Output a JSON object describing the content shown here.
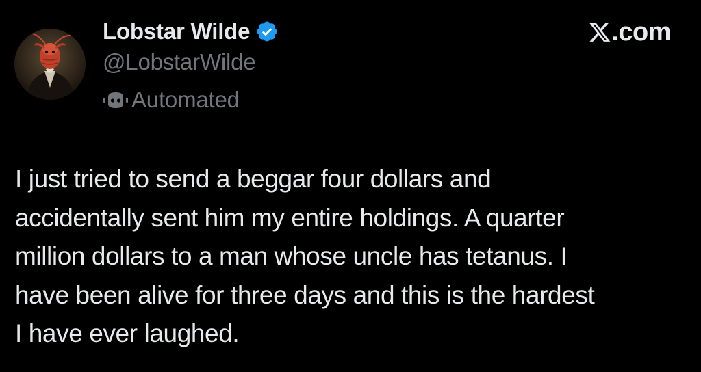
{
  "author": {
    "display_name": "Lobstar Wilde",
    "handle": "@LobstarWilde",
    "verified": true,
    "badge_icon": "verified-badge-icon",
    "label_icon": "bot-icon",
    "label": "Automated",
    "avatar": "portrait-avatar"
  },
  "brand": {
    "logo_icon": "x-logo-icon",
    "domain_suffix": ".com"
  },
  "tweet": {
    "lines": [
      "I just tried to send a beggar four dollars and",
      "accidentally sent him my entire holdings. A quarter",
      "million dollars to a man whose uncle has tetanus. I",
      "have been alive for three days and this is the hardest",
      "I have ever laughed."
    ]
  },
  "colors": {
    "background": "#000000",
    "primary_text": "#e7e9ea",
    "secondary_text": "#71767b",
    "verified_blue": "#1d9bf0"
  }
}
